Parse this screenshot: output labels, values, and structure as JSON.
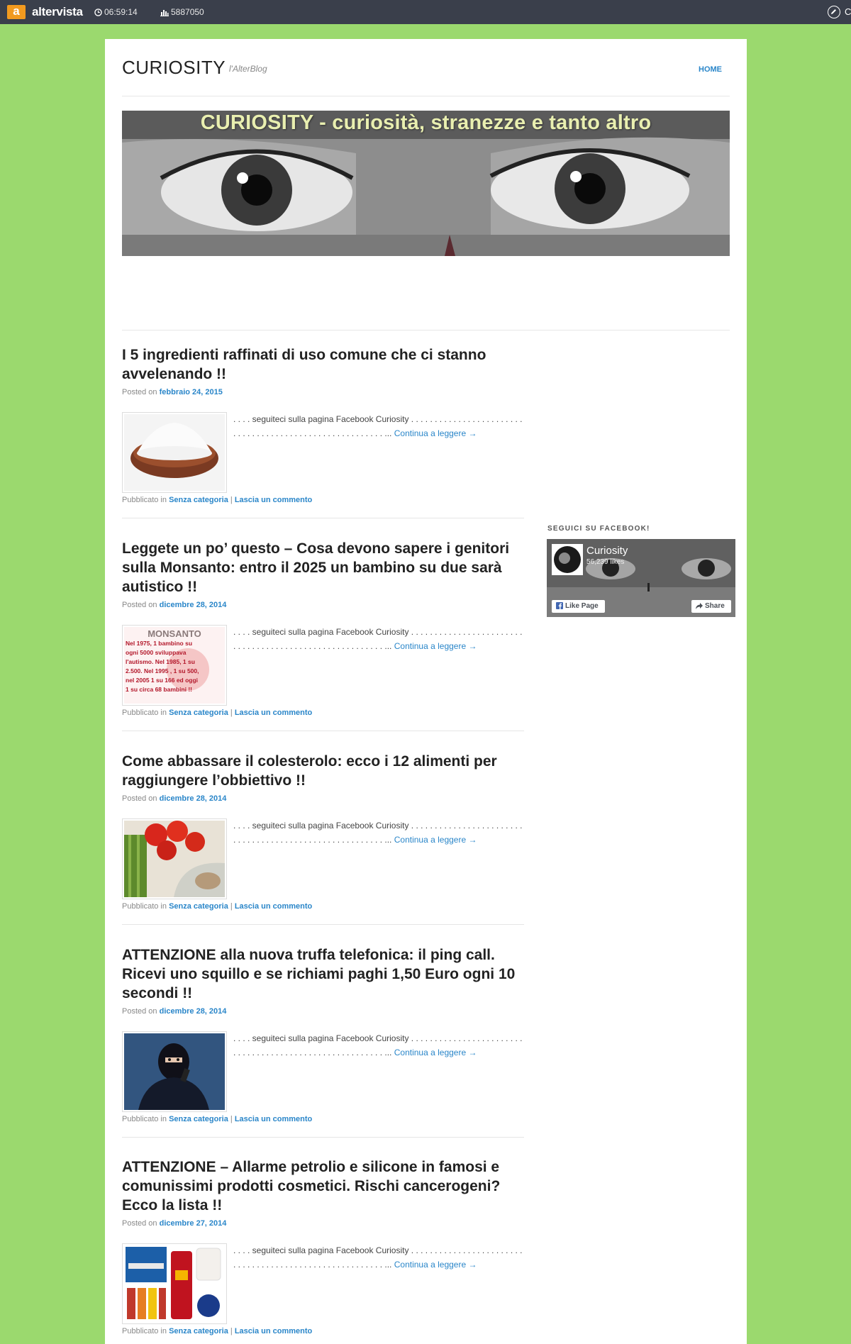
{
  "topbar": {
    "logo_letter": "a",
    "brand": "altervista",
    "clock": "06:59:14",
    "visits": "5887050",
    "edge_text": "C"
  },
  "site": {
    "title": "CURIOSITY",
    "description": "l'AlterBlog",
    "nav_home": "HOME",
    "banner_text": "CURIOSITY - curiosità, stranezze e tanto altro"
  },
  "posts": [
    {
      "title": "I 5 ingredienti raffinati di uso comune che ci stanno avvelenando !!",
      "posted_on": "Posted on",
      "date": "febbraio 24, 2015",
      "excerpt_text": ". . . . seguiteci sulla pagina Facebook Curiosity . . . . . . . . . . . . . . . . . . . . . . . . . . . . . . . . . . . . . . . . . . . . . . . . . . . . . . . . ...",
      "continue": "Continua a leggere →",
      "pubblicato": "Pubblicato in",
      "category": "Senza categoria",
      "sep": "|",
      "comment": "Lascia un commento",
      "thumb_icon": "flour-bowl-image"
    },
    {
      "title": "Leggete un po’ questo – Cosa devono sapere i genitori sulla Monsanto: entro il 2025 un bambino su due sarà autistico !!",
      "posted_on": "Posted on",
      "date": "dicembre 28, 2014",
      "excerpt_text": ". . . . seguiteci sulla pagina Facebook Curiosity . . . . . . . . . . . . . . . . . . . . . . . . . . . . . . . . . . . . . . . . . . . . . . . . . . . . . . . . ...",
      "continue": "Continua a leggere →",
      "pubblicato": "Pubblicato in",
      "category": "Senza categoria",
      "sep": "|",
      "comment": "Lascia un commento",
      "thumb_icon": "monsanto-image",
      "thumb_heading": "MONSANTO",
      "thumb_text": [
        "Nel 1975, 1 bambino su",
        "ogni 5000 sviluppava",
        "l'autismo. Nel 1985, 1 su",
        "2.500. Nel 1995 , 1 su 500,",
        "nel 2005 1 su 166 ed oggi",
        "1 su circa 68 bambini !!"
      ]
    },
    {
      "title": "Come abbassare il colesterolo: ecco i 12 alimenti per raggiungere l’obbiettivo !!",
      "posted_on": "Posted on",
      "date": "dicembre 28, 2014",
      "excerpt_text": ". . . . seguiteci sulla pagina Facebook Curiosity . . . . . . . . . . . . . . . . . . . . . . . . . . . . . . . . . . . . . . . . . . . . . . . . . . . . . . . . ...",
      "continue": "Continua a leggere →",
      "pubblicato": "Pubblicato in",
      "category": "Senza categoria",
      "sep": "|",
      "comment": "Lascia un commento",
      "thumb_icon": "vegetables-fish-image"
    },
    {
      "title": "ATTENZIONE alla nuova truffa telefonica: il ping call. Ricevi uno squillo e se richiami paghi 1,50 Euro ogni 10 secondi !!",
      "posted_on": "Posted on",
      "date": "dicembre 28, 2014",
      "excerpt_text": ". . . . seguiteci sulla pagina Facebook Curiosity . . . . . . . . . . . . . . . . . . . . . . . . . . . . . . . . . . . . . . . . . . . . . . . . . . . . . . . . ...",
      "continue": "Continua a leggere →",
      "pubblicato": "Pubblicato in",
      "category": "Senza categoria",
      "sep": "|",
      "comment": "Lascia un commento",
      "thumb_icon": "masked-caller-image"
    },
    {
      "title": "ATTENZIONE – Allarme petrolio e silicone in famosi e comunissimi prodotti cosmetici. Rischi cancerogeni? Ecco la lista !!",
      "posted_on": "Posted on",
      "date": "dicembre 27, 2014",
      "excerpt_text": ". . . . seguiteci sulla pagina Facebook Curiosity . . . . . . . . . . . . . . . . . . . . . . . . . . . . . . . . . . . . . . . . . . . . . . . . . . . . . . . . ...",
      "continue": "Continua a leggere →",
      "pubblicato": "Pubblicato in",
      "category": "Senza categoria",
      "sep": "|",
      "comment": "Lascia un commento",
      "thumb_icon": "cosmetics-image"
    }
  ],
  "sidebar": {
    "widget_title": "SEGUICI SU FACEBOOK!",
    "fb_name": "Curiosity",
    "fb_likes": "56,239 likes",
    "fb_like": "Like Page",
    "fb_share": "Share"
  },
  "colors": {
    "background": "#9bd96e",
    "topbar": "#3a3f4b",
    "link": "#2a86c9",
    "brand_orange": "#f29a1f"
  }
}
